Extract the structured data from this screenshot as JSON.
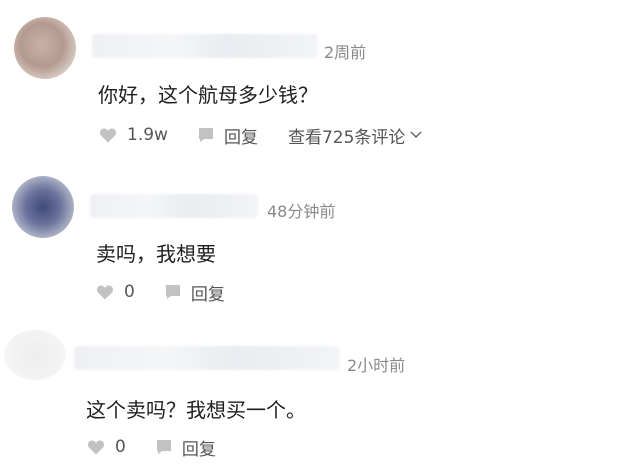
{
  "comments": [
    {
      "time": "2周前",
      "text": "你好，这个航母多少钱？",
      "likes": "1.9w",
      "reply_label": "回复",
      "view_replies": "查看725条评论"
    },
    {
      "time": "48分钟前",
      "text": "卖吗，我想要",
      "likes": "0",
      "reply_label": "回复"
    },
    {
      "time": "2小时前",
      "text": "这个卖吗？我想买一个。",
      "likes": "0",
      "reply_label": "回复"
    }
  ],
  "icons": {
    "like": "heart-icon",
    "reply": "comment-bubble-icon",
    "expand": "chevron-down-icon"
  },
  "colors": {
    "icon": "#c2c2c2",
    "meta_text": "#8a8a8a",
    "body_text": "#1e1e1e"
  }
}
